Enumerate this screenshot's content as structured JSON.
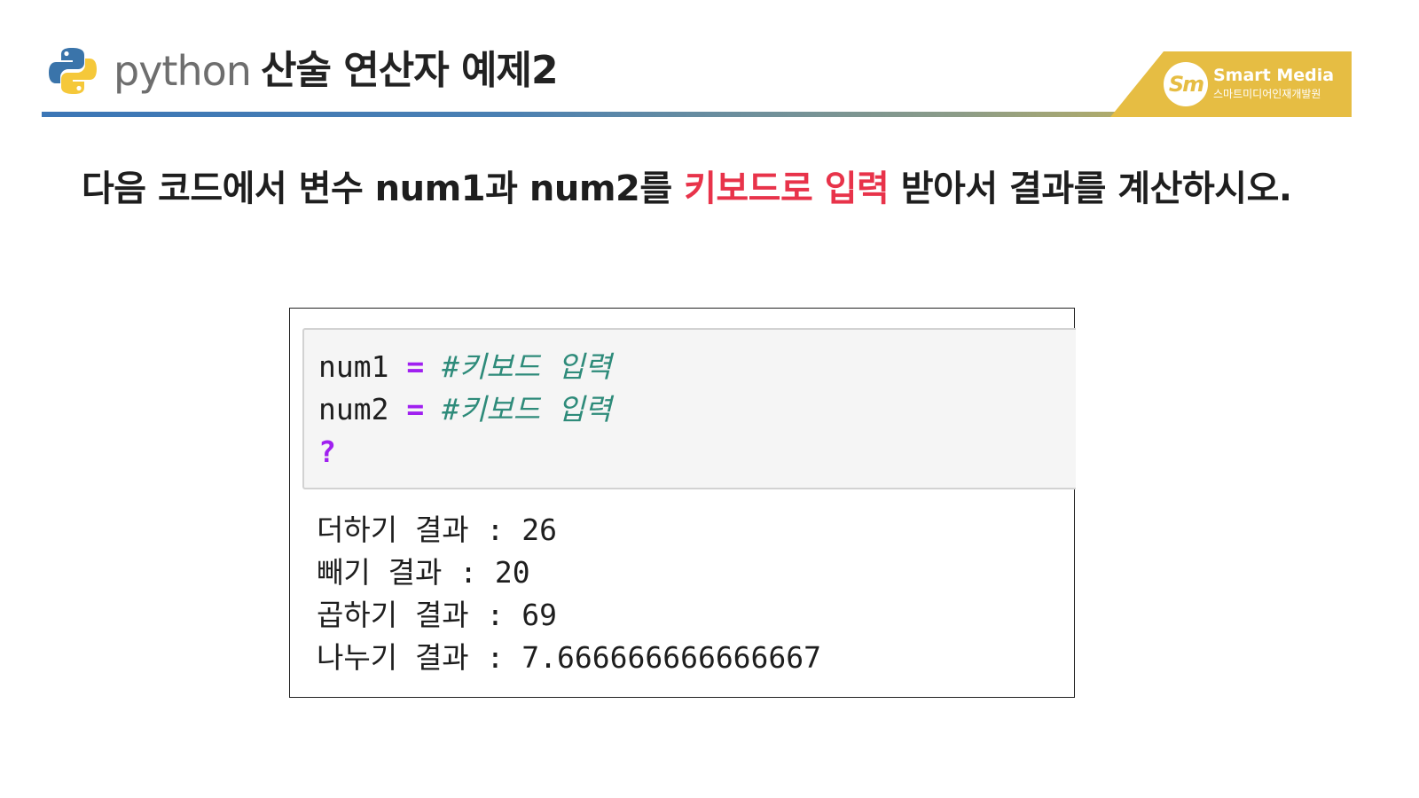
{
  "header": {
    "logo_word": "python",
    "title": "산술 연산자 예제2",
    "accent_gradient": [
      "#3b76b6",
      "#e6c14a"
    ]
  },
  "brand": {
    "mark": "Sm",
    "name": "Smart Media",
    "subtitle": "스마트미디어인재개발원",
    "color": "#e6bd43"
  },
  "instruction": {
    "before": "다음 코드에서 변수 num1과 num2를 ",
    "highlight": "키보드로 입력",
    "after": " 받아서 결과를 계산하시오.",
    "highlight_color": "#e8334a"
  },
  "code": {
    "lines": [
      {
        "var": "num1",
        "op": "=",
        "comment": "#키보드 입력"
      },
      {
        "var": "num2",
        "op": "=",
        "comment": "#키보드 입력"
      }
    ],
    "placeholder": "?"
  },
  "output": {
    "lines": [
      "더하기 결과 : 26",
      "빼기 결과 : 20",
      "곱하기 결과 : 69",
      "나누기 결과 : 7.666666666666667"
    ]
  }
}
